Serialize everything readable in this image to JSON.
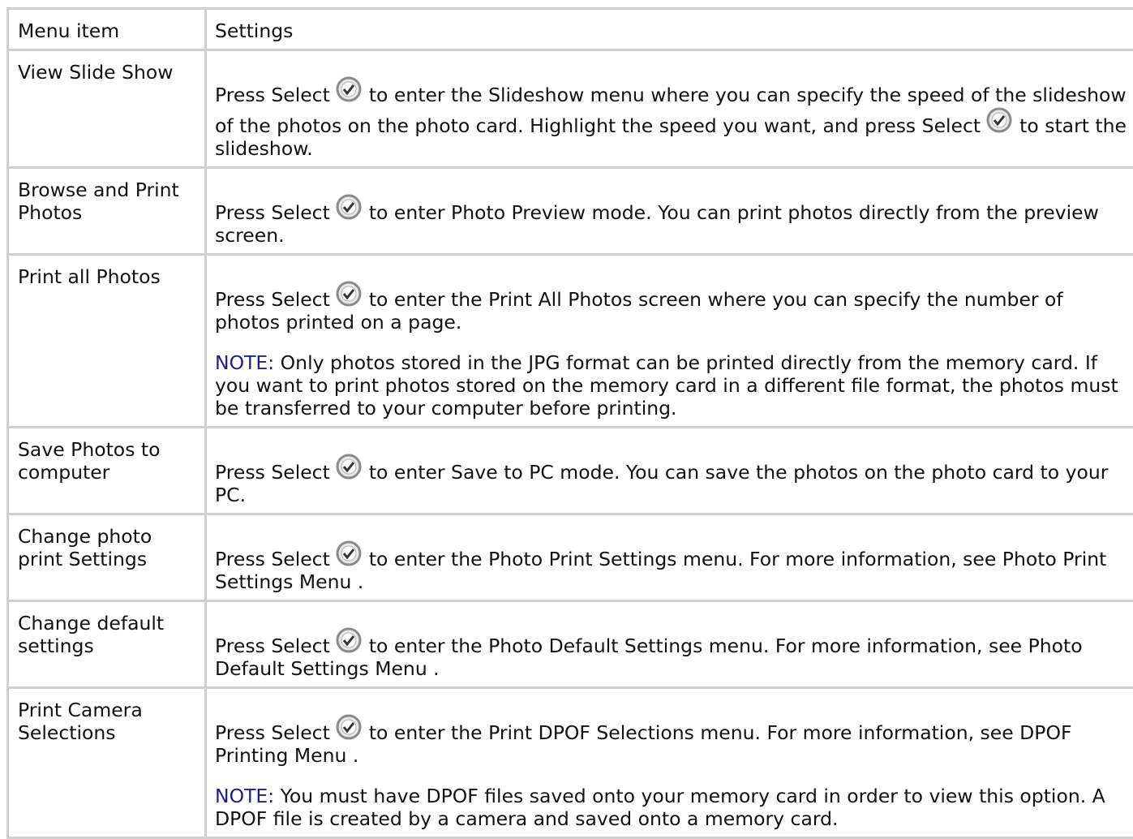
{
  "table": {
    "headers": [
      "Menu item",
      "Settings"
    ],
    "rows": [
      {
        "menu_item": "View Slide Show",
        "parts": [
          "Press Select",
          "to enter the Slideshow menu where you can specify the speed of the slideshow of the photos on the photo card. Highlight the speed you want, and press Select",
          "to start the slideshow."
        ]
      },
      {
        "menu_item": "Browse and Print Photos",
        "parts": [
          "Press Select",
          "to enter Photo Preview mode. You can print photos directly from the preview screen."
        ]
      },
      {
        "menu_item": "Print all Photos",
        "parts": [
          "Press Select",
          "to enter the Print All Photos screen where you can specify the number of photos printed on a page."
        ],
        "note_label": "NOTE:",
        "note_text": " Only photos stored in the JPG format can be printed directly from the memory card. If you want to print photos stored on the memory card in a different file format, the photos must be transferred to your computer before printing."
      },
      {
        "menu_item": "Save Photos to computer",
        "parts": [
          "Press Select",
          "to enter Save to PC mode. You can save the photos on the photo card to your PC."
        ]
      },
      {
        "menu_item": "Change photo print Settings",
        "parts": [
          "Press Select",
          "to enter the Photo Print Settings menu. For more information, see Photo Print Settings Menu ."
        ]
      },
      {
        "menu_item": "Change default settings",
        "parts": [
          "Press Select",
          "to enter the Photo Default Settings menu. For more information, see Photo Default Settings Menu ."
        ]
      },
      {
        "menu_item": "Print Camera Selections",
        "parts": [
          "Press Select",
          "to enter the Print DPOF Selections menu. For more information, see DPOF Printing Menu ."
        ],
        "note_label": "NOTE:",
        "note_text": " You must have DPOF files saved onto your memory card in order to view this option. A DPOF file is created by a camera and saved onto a memory card."
      }
    ]
  },
  "icons": {
    "select": "select-checkmark-icon"
  },
  "colors": {
    "border": "#cfcfcf",
    "note": "#1b1f8a"
  }
}
